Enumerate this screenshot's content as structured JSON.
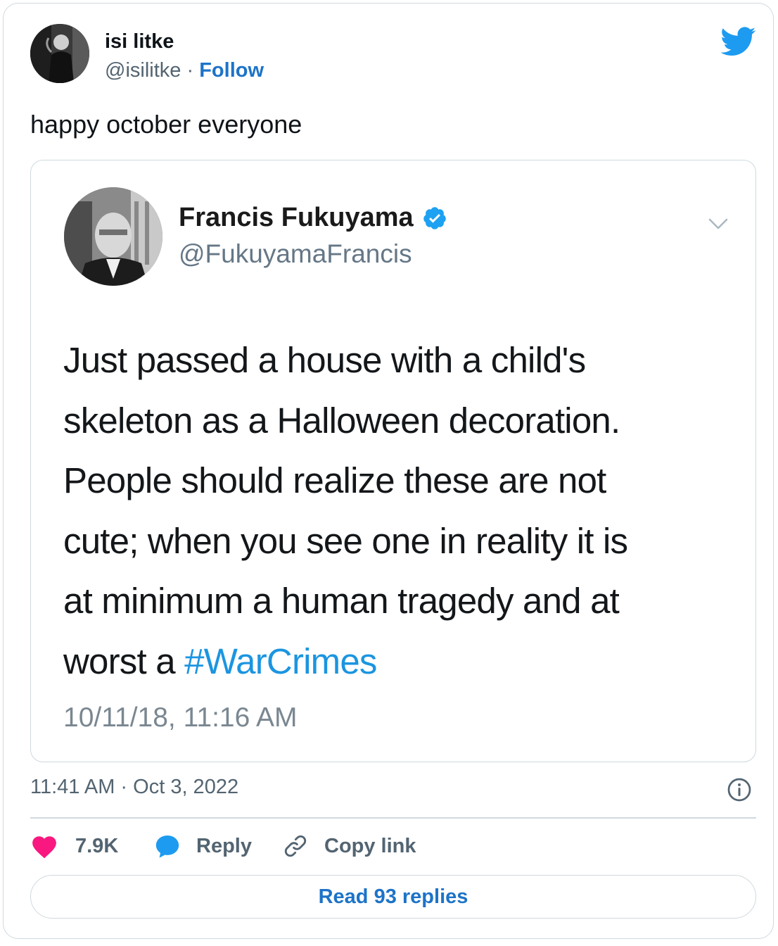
{
  "author": {
    "name": "isi litke",
    "handle": "@isilitke",
    "separator": "·",
    "follow_label": "Follow"
  },
  "tweet": {
    "text": "happy october everyone"
  },
  "quoted": {
    "name": "Francis Fukuyama",
    "handle": "@FukuyamaFrancis",
    "lines": [
      "Just passed a house with a child's",
      "skeleton as a Halloween decoration.",
      "People should realize these are not",
      "cute; when you see one in reality it is",
      "at minimum a human tragedy and at"
    ],
    "last_line_prefix": "worst a ",
    "hashtag": "#WarCrimes",
    "timestamp": "10/11/18, 11:16 AM"
  },
  "meta": {
    "time": "11:41 AM · Oct 3, 2022"
  },
  "actions": {
    "like_count": "7.9K",
    "reply_label": "Reply",
    "copy_label": "Copy link"
  },
  "read_replies_label": "Read 93 replies",
  "colors": {
    "link_blue": "#1d73c8",
    "hashtag_blue": "#1b95e0",
    "like_red": "#f91880",
    "reply_blue": "#1d9bf0",
    "border": "#cfd9de",
    "muted": "#536471"
  },
  "icons": {
    "brand": "twitter-bird-icon",
    "verified": "verified-badge-icon",
    "caret": "chevron-down-icon",
    "info": "info-icon",
    "like": "heart-icon",
    "reply": "speech-bubble-icon",
    "copy": "link-icon"
  }
}
